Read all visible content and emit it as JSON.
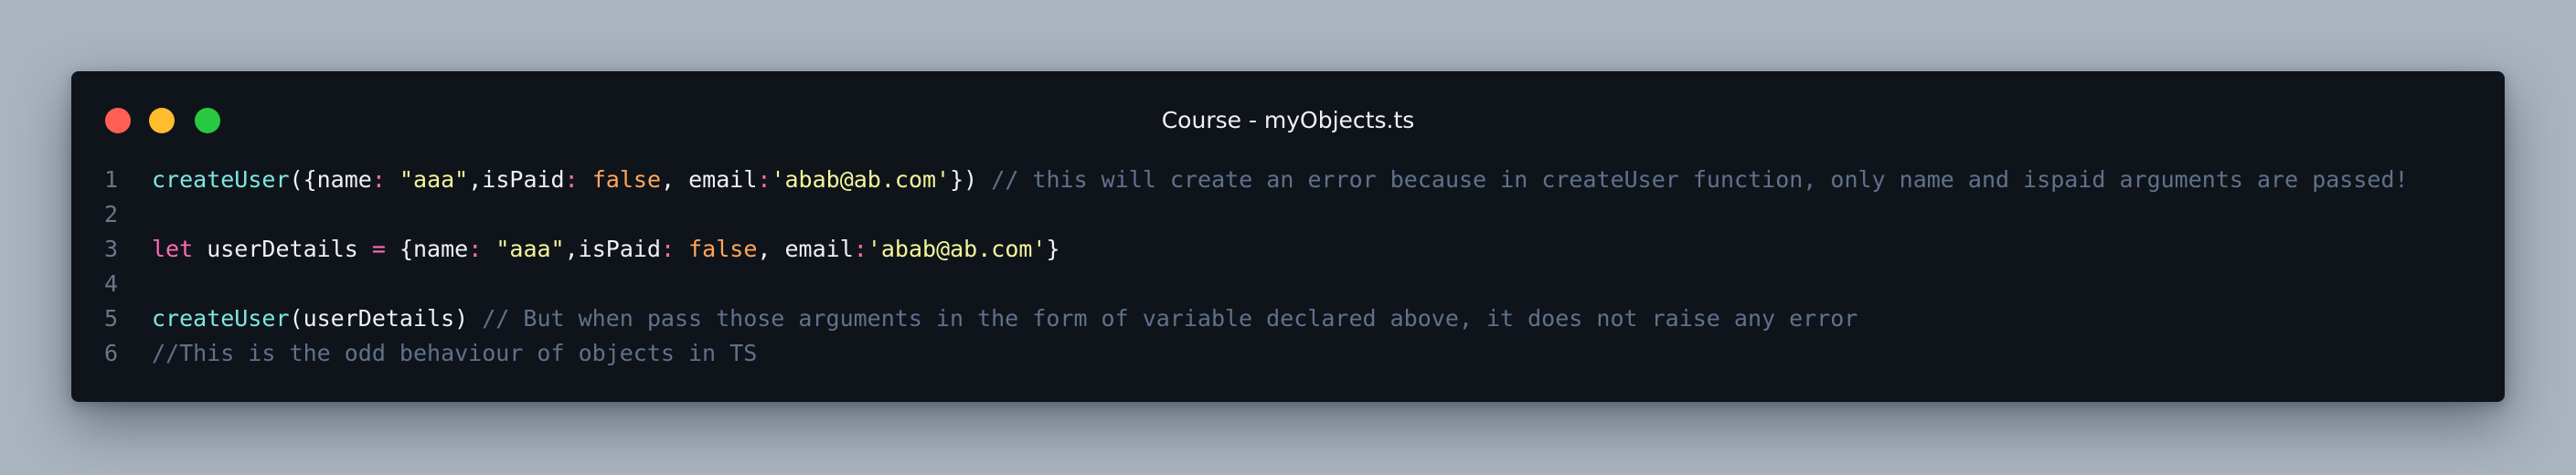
{
  "window": {
    "title": "Course - myObjects.ts"
  },
  "colors": {
    "background": "#aab4c0",
    "editor": "#0f141b",
    "close": "#ff5f57",
    "minimize": "#febc2e",
    "zoom": "#28c840"
  },
  "editor": {
    "lines": [
      {
        "number": "1",
        "tokens": [
          {
            "t": "createUser",
            "k": "fn"
          },
          {
            "t": "({",
            "k": "pn"
          },
          {
            "t": "name",
            "k": "prop"
          },
          {
            "t": ":",
            "k": "colon"
          },
          {
            "t": " ",
            "k": "pn"
          },
          {
            "t": "\"aaa\"",
            "k": "str"
          },
          {
            "t": ",",
            "k": "pn"
          },
          {
            "t": "isPaid",
            "k": "prop"
          },
          {
            "t": ":",
            "k": "colon"
          },
          {
            "t": " ",
            "k": "pn"
          },
          {
            "t": "false",
            "k": "bool"
          },
          {
            "t": ", ",
            "k": "pn"
          },
          {
            "t": "email",
            "k": "prop"
          },
          {
            "t": ":",
            "k": "colon"
          },
          {
            "t": "'abab@ab.com'",
            "k": "str"
          },
          {
            "t": "}) ",
            "k": "pn"
          },
          {
            "t": "// this will create an error because in createUser function, only name and ispaid arguments are passed!",
            "k": "cm"
          }
        ]
      },
      {
        "number": "2",
        "tokens": []
      },
      {
        "number": "3",
        "tokens": [
          {
            "t": "let",
            "k": "kw"
          },
          {
            "t": " userDetails ",
            "k": "pn"
          },
          {
            "t": "=",
            "k": "colon"
          },
          {
            "t": " {",
            "k": "pn"
          },
          {
            "t": "name",
            "k": "prop"
          },
          {
            "t": ":",
            "k": "colon"
          },
          {
            "t": " ",
            "k": "pn"
          },
          {
            "t": "\"aaa\"",
            "k": "str"
          },
          {
            "t": ",",
            "k": "pn"
          },
          {
            "t": "isPaid",
            "k": "prop"
          },
          {
            "t": ":",
            "k": "colon"
          },
          {
            "t": " ",
            "k": "pn"
          },
          {
            "t": "false",
            "k": "bool"
          },
          {
            "t": ", ",
            "k": "pn"
          },
          {
            "t": "email",
            "k": "prop"
          },
          {
            "t": ":",
            "k": "colon"
          },
          {
            "t": "'abab@ab.com'",
            "k": "str"
          },
          {
            "t": "}",
            "k": "pn"
          }
        ]
      },
      {
        "number": "4",
        "tokens": []
      },
      {
        "number": "5",
        "tokens": [
          {
            "t": "createUser",
            "k": "fn"
          },
          {
            "t": "(userDetails) ",
            "k": "pn"
          },
          {
            "t": "// But when pass those arguments in the form of variable declared above, it does not raise any error",
            "k": "cm"
          }
        ]
      },
      {
        "number": "6",
        "tokens": [
          {
            "t": "//This is the odd behaviour of objects in TS",
            "k": "cm"
          }
        ]
      }
    ]
  }
}
